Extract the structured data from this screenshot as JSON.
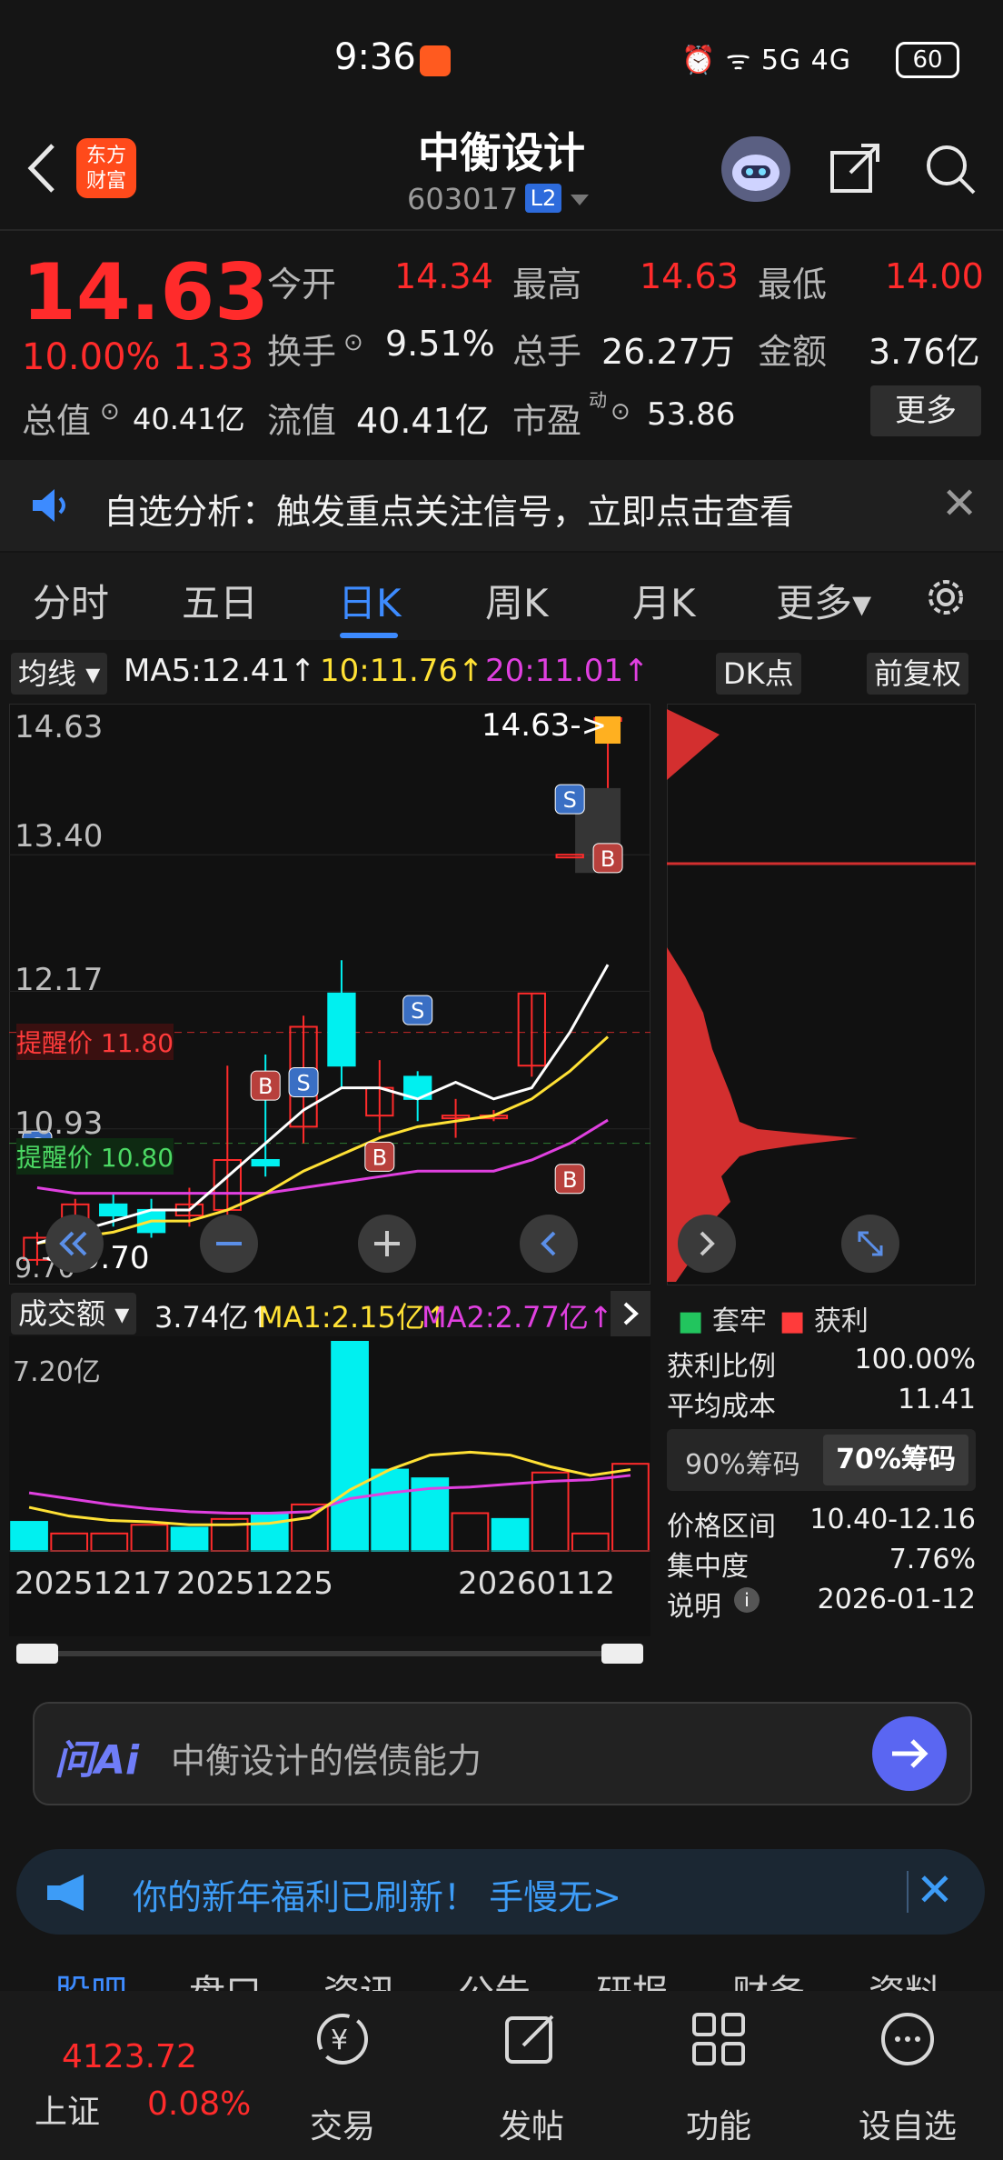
{
  "status_bar": {
    "time": "9:36",
    "right": "⏰ ᯤ 5G 4G",
    "battery": "60"
  },
  "header": {
    "title": "中衡设计",
    "code": "603017",
    "level": "L2",
    "logo_text": [
      "东方",
      "财富"
    ]
  },
  "quote": {
    "price": "14.63",
    "change_pct": "10.00%",
    "change": "1.33",
    "rows": [
      [
        {
          "label": "今开",
          "value": "14.34",
          "red": true
        },
        {
          "label": "最高",
          "value": "14.63",
          "red": true
        },
        {
          "label": "最低",
          "value": "14.00",
          "red": true
        }
      ],
      [
        {
          "label": "换手",
          "value": "9.51%",
          "red": false
        },
        {
          "label": "总手",
          "value": "26.27万",
          "red": false
        },
        {
          "label": "金额",
          "value": "3.76亿",
          "red": false
        }
      ]
    ],
    "row3": [
      {
        "label": "总值",
        "value": "40.41亿"
      },
      {
        "label": "流值",
        "value": "40.41亿"
      },
      {
        "label": "市盈",
        "sup": "动",
        "value": "53.86"
      }
    ],
    "more": "更多"
  },
  "notice": {
    "text": "自选分析：触发重点关注信号，立即点击查看"
  },
  "tabs": [
    "分时",
    "五日",
    "日K",
    "周K",
    "月K",
    "更多▾"
  ],
  "active_tab": "日K",
  "ma_bar": {
    "type": "均线",
    "ma5": "MA5:12.41↑",
    "ma10": "10:11.76↑",
    "ma20": "20:11.01↑",
    "dk": "DK点",
    "fq": "前复权"
  },
  "price_axis": [
    "14.63",
    "13.40",
    "12.17",
    "10.93",
    "9.70"
  ],
  "alerts": {
    "upper": "提醒价 11.80",
    "lower": "提醒价 10.80"
  },
  "price_labels": {
    "last": "14.63->",
    "low": "<-9.70"
  },
  "vol_bar": {
    "type": "成交额",
    "value": "3.74亿↑",
    "ma1": "MA1:2.15亿↑",
    "ma2": "MA2:2.77亿↑"
  },
  "vol_axis_top": "7.20亿",
  "dates": [
    "20251217",
    "20251225",
    "20260112"
  ],
  "chip": {
    "legend": [
      "套牢",
      "获利"
    ],
    "profit_ratio_label": "获利比例",
    "profit_ratio": "100.00%",
    "avg_cost_label": "平均成本",
    "avg_cost": "11.41",
    "tabs": [
      "90%筹码",
      "70%筹码"
    ],
    "active_tab": "70%筹码",
    "range_label": "价格区间",
    "range": "10.40-12.16",
    "concentration_label": "集中度",
    "concentration": "7.76%",
    "note_label": "说明",
    "note_date": "2026-01-12"
  },
  "ask_ai": {
    "logo": "问Ai",
    "placeholder": "中衡设计的偿债能力"
  },
  "promo": {
    "text": "你的新年福利已刷新！ 手慢无>"
  },
  "subtabs": [
    "股吧",
    "盘口",
    "资讯",
    "公告",
    "研报",
    "财务",
    "资料"
  ],
  "bottom_nav": {
    "index_value": "4123.72",
    "index_name": "上证",
    "index_pct": "0.08%",
    "items": [
      "交易",
      "发帖",
      "功能",
      "设自选"
    ]
  },
  "colors": {
    "up": "#ff2b2b",
    "down": "#00f0f0",
    "accent": "#3d8bff",
    "ma5": "#ffffff",
    "ma10": "#ffe135",
    "ma20": "#e040e0"
  },
  "chart_data": {
    "type": "candlestick",
    "candles": [
      {
        "o": 9.75,
        "c": 9.95,
        "h": 10.0,
        "l": 9.7
      },
      {
        "o": 10.0,
        "c": 10.25,
        "h": 10.3,
        "l": 9.9
      },
      {
        "o": 10.25,
        "c": 10.15,
        "h": 10.35,
        "l": 10.05
      },
      {
        "o": 10.2,
        "c": 10.0,
        "h": 10.3,
        "l": 9.95
      },
      {
        "o": 10.15,
        "c": 10.25,
        "h": 10.4,
        "l": 10.05
      },
      {
        "o": 10.2,
        "c": 10.65,
        "h": 11.5,
        "l": 10.1
      },
      {
        "o": 10.65,
        "c": 10.6,
        "h": 11.6,
        "l": 10.5
      },
      {
        "o": 10.95,
        "c": 11.85,
        "h": 11.95,
        "l": 10.8
      },
      {
        "o": 12.15,
        "c": 11.5,
        "h": 12.45,
        "l": 11.3
      },
      {
        "o": 11.05,
        "c": 11.3,
        "h": 11.55,
        "l": 10.9
      },
      {
        "o": 11.4,
        "c": 11.2,
        "h": 11.45,
        "l": 11.0
      },
      {
        "o": 11.05,
        "c": 11.05,
        "h": 11.2,
        "l": 10.85
      },
      {
        "o": 11.05,
        "c": 11.05,
        "h": 11.1,
        "l": 11.0
      },
      {
        "o": 11.5,
        "c": 12.15,
        "h": 12.15,
        "l": 11.4
      },
      {
        "o": 13.4,
        "c": 13.4,
        "h": 13.4,
        "l": 13.4
      },
      {
        "o": 14.63,
        "c": 14.63,
        "h": 14.63,
        "l": 14.0
      }
    ],
    "ma5": [
      9.9,
      10.0,
      10.1,
      10.2,
      10.2,
      10.5,
      10.8,
      11.1,
      11.3,
      11.3,
      11.2,
      11.35,
      11.2,
      11.3,
      11.8,
      12.41
    ],
    "ma10": [
      9.9,
      9.95,
      10.0,
      10.1,
      10.1,
      10.2,
      10.35,
      10.55,
      10.7,
      10.85,
      10.95,
      11.0,
      11.05,
      11.2,
      11.45,
      11.76
    ],
    "ma20": [
      10.4,
      10.35,
      10.35,
      10.35,
      10.35,
      10.35,
      10.35,
      10.4,
      10.45,
      10.5,
      10.55,
      10.55,
      10.55,
      10.65,
      10.8,
      11.01
    ],
    "signals": [
      {
        "i": 0,
        "t": "S"
      },
      {
        "i": 5,
        "t": "B"
      },
      {
        "i": 6,
        "t": "S"
      },
      {
        "i": 9,
        "t": "S"
      },
      {
        "i": 9,
        "t": "B2"
      },
      {
        "i": 14,
        "t": "B3"
      },
      {
        "i": 15,
        "t": "S2"
      },
      {
        "i": 15,
        "t": "B4"
      }
    ],
    "ylim": [
      9.7,
      14.63
    ],
    "volume": [
      {
        "v": 1.0,
        "up": false
      },
      {
        "v": 0.6,
        "up": true
      },
      {
        "v": 0.6,
        "up": true
      },
      {
        "v": 0.9,
        "up": true
      },
      {
        "v": 0.8,
        "up": false
      },
      {
        "v": 1.1,
        "up": true
      },
      {
        "v": 1.3,
        "up": false
      },
      {
        "v": 1.6,
        "up": true
      },
      {
        "v": 7.2,
        "up": false
      },
      {
        "v": 2.8,
        "up": false
      },
      {
        "v": 2.5,
        "up": false
      },
      {
        "v": 1.3,
        "up": true
      },
      {
        "v": 1.1,
        "up": false
      },
      {
        "v": 2.7,
        "up": true
      },
      {
        "v": 0.6,
        "up": true
      },
      {
        "v": 3.0,
        "up": true
      }
    ],
    "vol_ma1": [
      1.5,
      1.2,
      1.05,
      1.0,
      0.9,
      0.9,
      0.95,
      1.15,
      2.1,
      2.8,
      3.3,
      3.4,
      3.3,
      2.9,
      2.6,
      2.8
    ],
    "vol_ma2": [
      2.0,
      1.8,
      1.6,
      1.45,
      1.35,
      1.3,
      1.3,
      1.35,
      1.8,
      2.0,
      2.15,
      2.2,
      2.3,
      2.4,
      2.45,
      2.6
    ],
    "vol_ylim": [
      0,
      7.2
    ]
  }
}
